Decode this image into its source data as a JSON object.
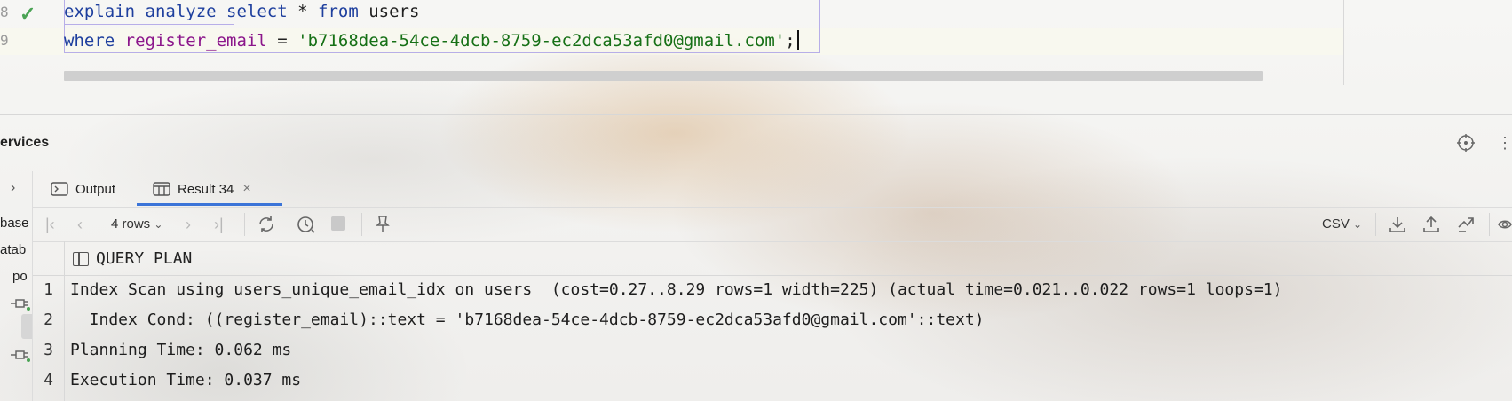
{
  "editor": {
    "line_numbers": [
      "8",
      "9"
    ],
    "line1": {
      "kw1": "explain analyze",
      "kw2": "select",
      "sym": " * ",
      "kw3": "from",
      "ident": " users"
    },
    "line2": {
      "kw1": "where",
      "column": "register_email",
      "op": " = ",
      "string": "'b7168dea-54ce-4dcb-8759-ec2dca53afd0@gmail.com'",
      "end": ";"
    }
  },
  "services": {
    "title": "ervices"
  },
  "left_panel": {
    "items": [
      "base",
      "atab",
      "po"
    ]
  },
  "tabs": [
    {
      "label": "Output"
    },
    {
      "label": "Result 34",
      "close": "×"
    }
  ],
  "toolbar": {
    "rows_label": "4 rows",
    "export_format": "CSV"
  },
  "grid": {
    "column_header": "QUERY PLAN",
    "rows": [
      {
        "num": "1",
        "text": "Index Scan using users_unique_email_idx on users  (cost=0.27..8.29 rows=1 width=225) (actual time=0.021..0.022 rows=1 loops=1)"
      },
      {
        "num": "2",
        "text": "  Index Cond: ((register_email)::text = 'b7168dea-54ce-4dcb-8759-ec2dca53afd0@gmail.com'::text)"
      },
      {
        "num": "3",
        "text": "Planning Time: 0.062 ms"
      },
      {
        "num": "4",
        "text": "Execution Time: 0.037 ms"
      }
    ]
  },
  "colors": {
    "accent": "#3b74d8",
    "keyword": "#1e3f9e",
    "string": "#167016",
    "column": "#8b168b",
    "check": "#4aa354"
  }
}
